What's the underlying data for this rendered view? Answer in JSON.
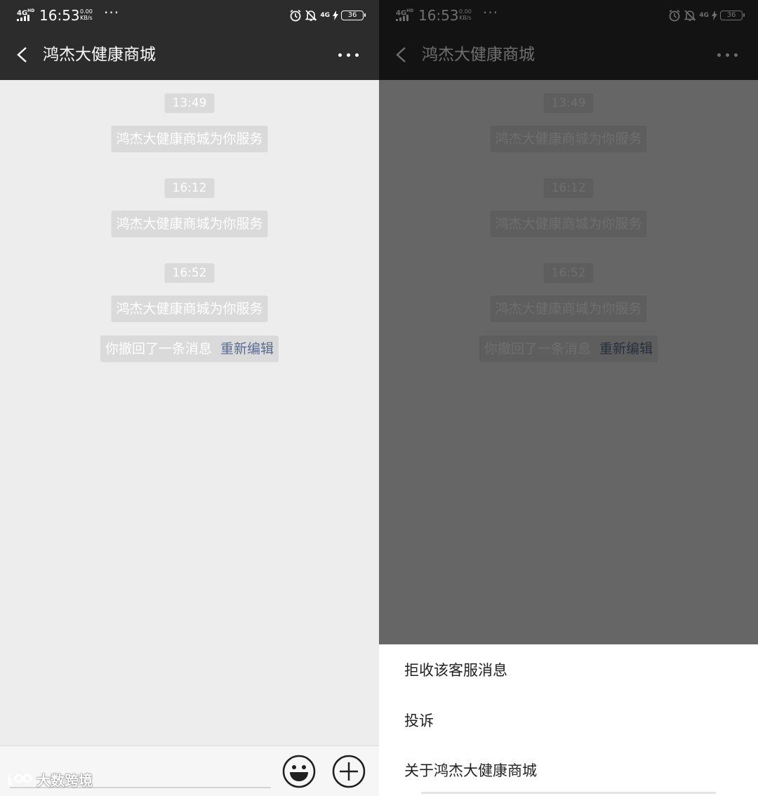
{
  "status_bar": {
    "network_left": "4G",
    "network_left_sub": "HD",
    "time": "16:53",
    "speed_value": "0.00",
    "speed_unit": "KB/s",
    "network_right": "4G",
    "battery": "36"
  },
  "header": {
    "title": "鸿杰大健康商城"
  },
  "chat": {
    "messages": [
      {
        "time": "13:49",
        "text": "鸿杰大健康商城为你服务"
      },
      {
        "time": "16:12",
        "text": "鸿杰大健康商城为你服务"
      },
      {
        "time": "16:52",
        "text": "鸿杰大健康商城为你服务"
      }
    ],
    "recall_notice": "你撤回了一条消息",
    "recall_action": "重新编辑"
  },
  "watermark": {
    "text": "大数跨境"
  },
  "action_sheet": {
    "items": [
      {
        "label": "拒收该客服消息"
      },
      {
        "label": "投诉"
      },
      {
        "label": "关于鸿杰大健康商城"
      }
    ]
  },
  "colors": {
    "bar_background": "#2c2c2c",
    "chat_background": "#ededed",
    "bubble_background": "#dadada",
    "link": "#5b6b8f",
    "overlay": "rgba(0,0,0,0.57)"
  }
}
